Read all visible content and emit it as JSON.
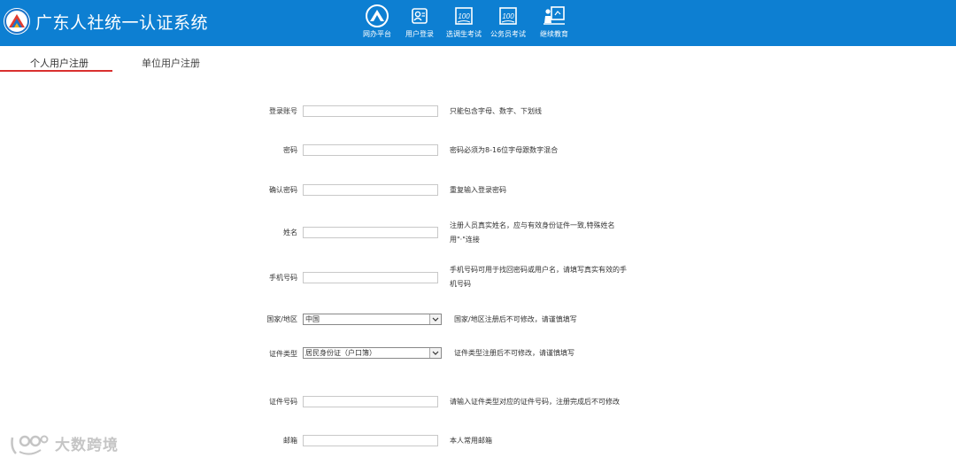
{
  "header": {
    "site_title": "广东人社统一认证系统",
    "bg_color": "#0d7fd2",
    "nav": [
      {
        "label": "网办平台",
        "icon": "ohrss-logo-icon"
      },
      {
        "label": "用户登录",
        "icon": "user-card-icon"
      },
      {
        "label": "选调生考试",
        "icon": "exam-paper-icon"
      },
      {
        "label": "公务员考试",
        "icon": "exam-paper-icon"
      },
      {
        "label": "继续教育",
        "icon": "teacher-board-icon"
      }
    ]
  },
  "tabs": [
    {
      "label": "个人用户注册",
      "active": true
    },
    {
      "label": "单位用户注册",
      "active": false
    }
  ],
  "accent_color": "#d9302f",
  "form": {
    "login_account": {
      "label": "登录账号",
      "value": "",
      "hint": "只能包含字母、数字、下划线"
    },
    "password": {
      "label": "密码",
      "value": "",
      "hint": "密码必须为8-16位字母跟数字混合"
    },
    "confirm_password": {
      "label": "确认密码",
      "value": "",
      "hint": "重复输入登录密码"
    },
    "name": {
      "label": "姓名",
      "value": "",
      "hint_line1": "注册人员真实姓名，应与有效身份证件一致,特殊姓名",
      "hint_line2": "用\"·\"连接"
    },
    "phone": {
      "label": "手机号码",
      "value": "",
      "hint_line1": "手机号码可用于找回密码或用户名，请填写真实有效的手",
      "hint_line2": "机号码"
    },
    "country": {
      "label": "国家/地区",
      "value": "中国",
      "hint": "国家/地区注册后不可修改，请谨慎填写"
    },
    "id_type": {
      "label": "证件类型",
      "value": "居民身份证（户口簿）",
      "hint": "证件类型注册后不可修改，请谨慎填写"
    },
    "id_number": {
      "label": "证件号码",
      "value": "",
      "hint": "请输入证件类型对应的证件号码，注册完成后不可修改"
    },
    "email": {
      "label": "邮箱",
      "value": "",
      "hint": "本人常用邮箱"
    }
  },
  "watermark": {
    "text": "大数跨境"
  }
}
